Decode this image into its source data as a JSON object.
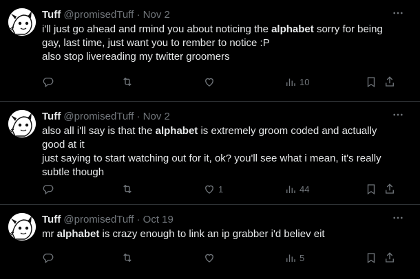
{
  "tweets": [
    {
      "name": "Tuff",
      "handle": "@promisedTuff",
      "separator": "·",
      "date": "Nov 2",
      "lines": [
        {
          "pre": "i'll just go ahead and rmind you about noticing the ",
          "bold": "alphabet",
          "post": " sorry for being"
        },
        {
          "pre": "gay, last time, just want you to rember to notice :P",
          "bold": "",
          "post": ""
        },
        {
          "pre": "also stop livereading my twitter groomers",
          "bold": "",
          "post": ""
        }
      ],
      "likes": "",
      "views": "10"
    },
    {
      "name": "Tuff",
      "handle": "@promisedTuff",
      "separator": "·",
      "date": "Nov 2",
      "lines": [
        {
          "pre": "also all i'll say is that the ",
          "bold": "alphabet",
          "post": " is extremely groom coded and actually"
        },
        {
          "pre": "good at it",
          "bold": "",
          "post": ""
        },
        {
          "pre": "just saying to start watching out for it, ok? you'll see what i mean, it's really",
          "bold": "",
          "post": ""
        },
        {
          "pre": "subtle though",
          "bold": "",
          "post": ""
        }
      ],
      "likes": "1",
      "views": "44"
    },
    {
      "name": "Tuff",
      "handle": "@promisedTuff",
      "separator": "·",
      "date": "Oct 19",
      "lines": [
        {
          "pre": "mr ",
          "bold": "alphabet",
          "post": " is crazy enough to link an ip grabber i'd believ eit"
        }
      ],
      "likes": "",
      "views": "5"
    }
  ],
  "icons": {
    "more": "more-icon",
    "reply": "reply-icon",
    "retweet": "retweet-icon",
    "like": "like-icon",
    "views": "views-icon",
    "bookmark": "bookmark-icon",
    "share": "share-icon"
  }
}
